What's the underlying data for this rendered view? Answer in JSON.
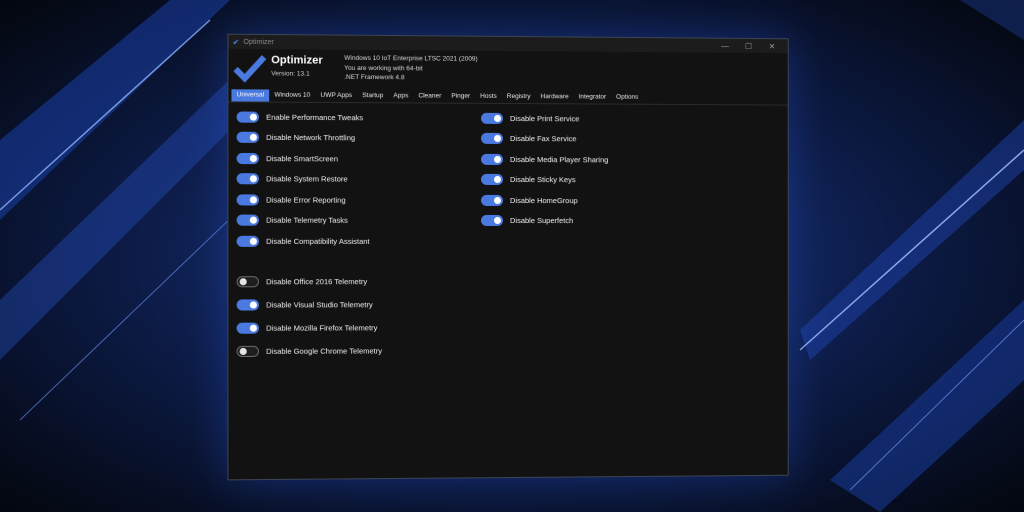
{
  "window": {
    "title": "Optimizer",
    "controls": {
      "minimize": "—",
      "maximize": "☐",
      "close": "✕"
    }
  },
  "header": {
    "app_name": "Optimizer",
    "version": "Version: 13.1",
    "sys_info": [
      "Windows 10 IoT Enterprise LTSC 2021 (2009)",
      "You are working with 64-bit",
      ".NET Framework 4.8"
    ]
  },
  "tabs": [
    {
      "label": "Universal",
      "active": true
    },
    {
      "label": "Windows 10"
    },
    {
      "label": "UWP Apps"
    },
    {
      "label": "Startup"
    },
    {
      "label": "Apps"
    },
    {
      "label": "Cleaner"
    },
    {
      "label": "Pinger"
    },
    {
      "label": "Hosts"
    },
    {
      "label": "Registry"
    },
    {
      "label": "Hardware"
    },
    {
      "label": "Integrator"
    },
    {
      "label": "Options"
    }
  ],
  "left_toggles": [
    {
      "label": "Enable Performance Tweaks",
      "on": true
    },
    {
      "label": "Disable Network Throttling",
      "on": true
    },
    {
      "label": "Disable SmartScreen",
      "on": true
    },
    {
      "label": "Disable System Restore",
      "on": true
    },
    {
      "label": "Disable Error Reporting",
      "on": true
    },
    {
      "label": "Disable Telemetry Tasks",
      "on": true
    },
    {
      "label": "Disable Compatibility Assistant",
      "on": true
    }
  ],
  "left_toggles_2": [
    {
      "label": "Disable Office 2016 Telemetry",
      "on": false
    },
    {
      "label": "Disable Visual Studio Telemetry",
      "on": true
    },
    {
      "label": "Disable Mozilla Firefox Telemetry",
      "on": true
    },
    {
      "label": "Disable Google Chrome Telemetry",
      "on": false
    }
  ],
  "right_toggles": [
    {
      "label": "Disable Print Service",
      "on": true
    },
    {
      "label": "Disable Fax Service",
      "on": true
    },
    {
      "label": "Disable Media Player Sharing",
      "on": true
    },
    {
      "label": "Disable Sticky Keys",
      "on": true
    },
    {
      "label": "Disable HomeGroup",
      "on": true
    },
    {
      "label": "Disable Superfetch",
      "on": true
    }
  ],
  "colors": {
    "accent": "#4a79e0",
    "window_bg": "#121212"
  }
}
